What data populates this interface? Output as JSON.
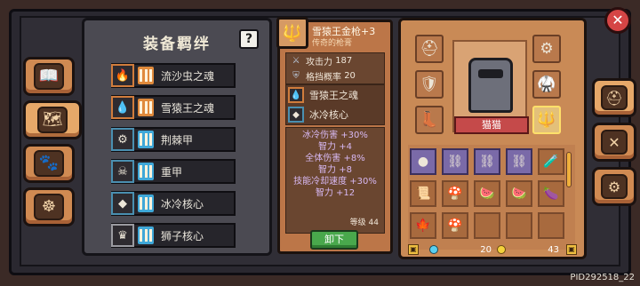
{
  "bonds_panel": {
    "title": "装备羁绊",
    "help_label": "?",
    "rows": [
      {
        "label": "流沙虫之魂",
        "icon": "fire-orb-icon",
        "glyph": "🔥",
        "theme": "orange"
      },
      {
        "label": "雪猿王之魂",
        "icon": "blue-flame-icon",
        "glyph": "💧",
        "theme": "orange"
      },
      {
        "label": "荆棘甲",
        "icon": "gear-icon",
        "glyph": "⚙",
        "theme": "blue"
      },
      {
        "label": "重甲",
        "icon": "skull-icon",
        "glyph": "☠",
        "theme": "blue"
      },
      {
        "label": "冰冷核心",
        "icon": "ice-crystal-icon",
        "glyph": "◆",
        "theme": "blue"
      },
      {
        "label": "狮子核心",
        "icon": "lion-head-icon",
        "glyph": "♛",
        "theme": "grey"
      }
    ]
  },
  "item_detail": {
    "name": "雪猿王金枪+3",
    "subtitle": "传奇的枪膏",
    "stats": [
      {
        "icon": "sword-icon",
        "glyph": "⚔",
        "label": "攻击力",
        "value": "187"
      },
      {
        "icon": "shield-icon",
        "glyph": "⛨",
        "label": "格挡概率",
        "value": "20"
      }
    ],
    "bonds": [
      {
        "label": "雪猿王之魂",
        "icon": "blue-flame-icon",
        "glyph": "💧",
        "theme": "orange"
      },
      {
        "label": "冰冷核心",
        "icon": "ice-crystal-icon",
        "glyph": "◆",
        "theme": "blue"
      }
    ],
    "effects": [
      "冰冷伤害 +30%",
      "智力 +4",
      "全体伤害 +8%",
      "智力 +8",
      "技能冷却速度 +30%",
      "智力 +12"
    ],
    "level": "等级 44",
    "unequip_label": "卸下"
  },
  "character": {
    "name": "猫猫"
  },
  "currency": {
    "gems": "20",
    "coins": "43"
  },
  "footer": {
    "pid": "PID292518_22"
  }
}
